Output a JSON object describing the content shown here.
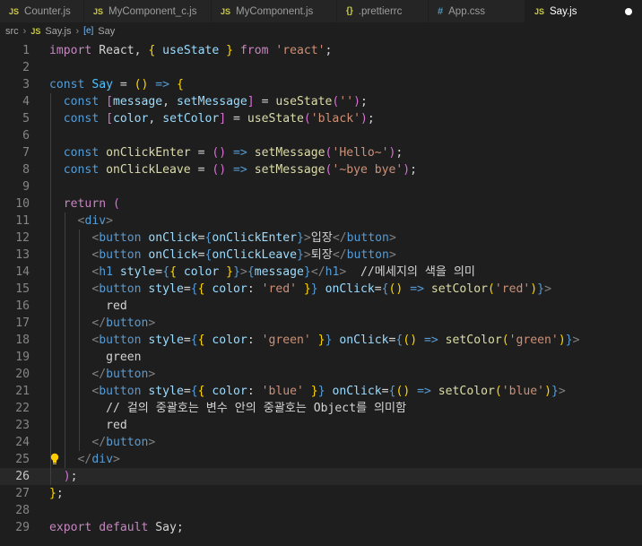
{
  "tabs": [
    {
      "icon": "JS",
      "label": "Counter.js",
      "active": false
    },
    {
      "icon": "JS",
      "label": "MyComponent_c.js",
      "active": false
    },
    {
      "icon": "JS",
      "label": "MyComponent.js",
      "active": false
    },
    {
      "icon": "{}",
      "label": ".prettierrc",
      "active": false
    },
    {
      "icon": "#",
      "label": "App.css",
      "active": false
    },
    {
      "icon": "JS",
      "label": "Say.js",
      "active": true,
      "dirty": true
    }
  ],
  "breadcrumb": {
    "folder": "src",
    "file_icon": "JS",
    "file": "Say.js",
    "symbol_icon": "[e]",
    "symbol": "Say"
  },
  "editor": {
    "current_line": 26,
    "lightbulb_line": 25,
    "lines": [
      {
        "n": 1,
        "tokens": [
          [
            "k",
            "import"
          ],
          [
            "p",
            " React, "
          ],
          [
            "b1",
            "{"
          ],
          [
            "p",
            " "
          ],
          [
            "v",
            "useState"
          ],
          [
            "p",
            " "
          ],
          [
            "b1",
            "}"
          ],
          [
            "p",
            " "
          ],
          [
            "k",
            "from"
          ],
          [
            "p",
            " "
          ],
          [
            "s",
            "'react'"
          ],
          [
            "p",
            ";"
          ]
        ]
      },
      {
        "n": 2,
        "tokens": []
      },
      {
        "n": 3,
        "tokens": [
          [
            "kb",
            "const"
          ],
          [
            "p",
            " "
          ],
          [
            "c",
            "Say"
          ],
          [
            "p",
            " = "
          ],
          [
            "b1",
            "()"
          ],
          [
            "p",
            " "
          ],
          [
            "kb",
            "=>"
          ],
          [
            "p",
            " "
          ],
          [
            "b1",
            "{"
          ]
        ]
      },
      {
        "n": 4,
        "tokens": [
          [
            "p",
            "  "
          ],
          [
            "kb",
            "const"
          ],
          [
            "p",
            " "
          ],
          [
            "b2",
            "["
          ],
          [
            "v",
            "message"
          ],
          [
            "p",
            ", "
          ],
          [
            "v",
            "setMessage"
          ],
          [
            "b2",
            "]"
          ],
          [
            "p",
            " = "
          ],
          [
            "f",
            "useState"
          ],
          [
            "b2",
            "("
          ],
          [
            "s",
            "''"
          ],
          [
            "b2",
            ")"
          ],
          [
            "p",
            ";"
          ]
        ]
      },
      {
        "n": 5,
        "tokens": [
          [
            "p",
            "  "
          ],
          [
            "kb",
            "const"
          ],
          [
            "p",
            " "
          ],
          [
            "b2",
            "["
          ],
          [
            "v",
            "color"
          ],
          [
            "p",
            ", "
          ],
          [
            "v",
            "setColor"
          ],
          [
            "b2",
            "]"
          ],
          [
            "p",
            " = "
          ],
          [
            "f",
            "useState"
          ],
          [
            "b2",
            "("
          ],
          [
            "s",
            "'black'"
          ],
          [
            "b2",
            ")"
          ],
          [
            "p",
            ";"
          ]
        ]
      },
      {
        "n": 6,
        "tokens": []
      },
      {
        "n": 7,
        "tokens": [
          [
            "p",
            "  "
          ],
          [
            "kb",
            "const"
          ],
          [
            "p",
            " "
          ],
          [
            "f",
            "onClickEnter"
          ],
          [
            "p",
            " = "
          ],
          [
            "b2",
            "()"
          ],
          [
            "p",
            " "
          ],
          [
            "kb",
            "=>"
          ],
          [
            "p",
            " "
          ],
          [
            "f",
            "setMessage"
          ],
          [
            "b2",
            "("
          ],
          [
            "s",
            "'Hello~'"
          ],
          [
            "b2",
            ")"
          ],
          [
            "p",
            ";"
          ]
        ]
      },
      {
        "n": 8,
        "tokens": [
          [
            "p",
            "  "
          ],
          [
            "kb",
            "const"
          ],
          [
            "p",
            " "
          ],
          [
            "f",
            "onClickLeave"
          ],
          [
            "p",
            " = "
          ],
          [
            "b2",
            "()"
          ],
          [
            "p",
            " "
          ],
          [
            "kb",
            "=>"
          ],
          [
            "p",
            " "
          ],
          [
            "f",
            "setMessage"
          ],
          [
            "b2",
            "("
          ],
          [
            "s",
            "'~bye bye'"
          ],
          [
            "b2",
            ")"
          ],
          [
            "p",
            ";"
          ]
        ]
      },
      {
        "n": 9,
        "tokens": []
      },
      {
        "n": 10,
        "tokens": [
          [
            "p",
            "  "
          ],
          [
            "k",
            "return"
          ],
          [
            "p",
            " "
          ],
          [
            "b2",
            "("
          ]
        ]
      },
      {
        "n": 11,
        "tokens": [
          [
            "p",
            "    "
          ],
          [
            "tg",
            "<"
          ],
          [
            "t",
            "div"
          ],
          [
            "tg",
            ">"
          ]
        ]
      },
      {
        "n": 12,
        "tokens": [
          [
            "p",
            "      "
          ],
          [
            "tg",
            "<"
          ],
          [
            "t",
            "button"
          ],
          [
            "p",
            " "
          ],
          [
            "v",
            "onClick"
          ],
          [
            "p",
            "="
          ],
          [
            "t",
            "{"
          ],
          [
            "v",
            "onClickEnter"
          ],
          [
            "t",
            "}"
          ],
          [
            "tg",
            ">"
          ],
          [
            "p",
            "입장"
          ],
          [
            "tg",
            "</"
          ],
          [
            "t",
            "button"
          ],
          [
            "tg",
            ">"
          ]
        ]
      },
      {
        "n": 13,
        "tokens": [
          [
            "p",
            "      "
          ],
          [
            "tg",
            "<"
          ],
          [
            "t",
            "button"
          ],
          [
            "p",
            " "
          ],
          [
            "v",
            "onClick"
          ],
          [
            "p",
            "="
          ],
          [
            "t",
            "{"
          ],
          [
            "v",
            "onClickLeave"
          ],
          [
            "t",
            "}"
          ],
          [
            "tg",
            ">"
          ],
          [
            "p",
            "퇴장"
          ],
          [
            "tg",
            "</"
          ],
          [
            "t",
            "button"
          ],
          [
            "tg",
            ">"
          ]
        ]
      },
      {
        "n": 14,
        "tokens": [
          [
            "p",
            "      "
          ],
          [
            "tg",
            "<"
          ],
          [
            "t",
            "h1"
          ],
          [
            "p",
            " "
          ],
          [
            "v",
            "style"
          ],
          [
            "p",
            "="
          ],
          [
            "t",
            "{"
          ],
          [
            "b1",
            "{"
          ],
          [
            "p",
            " "
          ],
          [
            "v",
            "color"
          ],
          [
            "p",
            " "
          ],
          [
            "b1",
            "}"
          ],
          [
            "t",
            "}"
          ],
          [
            "tg",
            ">"
          ],
          [
            "t",
            "{"
          ],
          [
            "v",
            "message"
          ],
          [
            "t",
            "}"
          ],
          [
            "tg",
            "</"
          ],
          [
            "t",
            "h1"
          ],
          [
            "tg",
            ">"
          ],
          [
            "p",
            "  //메세지의 색을 의미"
          ]
        ]
      },
      {
        "n": 15,
        "tokens": [
          [
            "p",
            "      "
          ],
          [
            "tg",
            "<"
          ],
          [
            "t",
            "button"
          ],
          [
            "p",
            " "
          ],
          [
            "v",
            "style"
          ],
          [
            "p",
            "="
          ],
          [
            "t",
            "{"
          ],
          [
            "b1",
            "{"
          ],
          [
            "p",
            " "
          ],
          [
            "v",
            "color"
          ],
          [
            "p",
            ": "
          ],
          [
            "s",
            "'red'"
          ],
          [
            "p",
            " "
          ],
          [
            "b1",
            "}"
          ],
          [
            "t",
            "}"
          ],
          [
            "p",
            " "
          ],
          [
            "v",
            "onClick"
          ],
          [
            "p",
            "="
          ],
          [
            "t",
            "{"
          ],
          [
            "b1",
            "()"
          ],
          [
            "p",
            " "
          ],
          [
            "kb",
            "=>"
          ],
          [
            "p",
            " "
          ],
          [
            "f",
            "setColor"
          ],
          [
            "b1",
            "("
          ],
          [
            "s",
            "'red'"
          ],
          [
            "b1",
            ")"
          ],
          [
            "t",
            "}"
          ],
          [
            "tg",
            ">"
          ]
        ]
      },
      {
        "n": 16,
        "tokens": [
          [
            "p",
            "        red"
          ]
        ]
      },
      {
        "n": 17,
        "tokens": [
          [
            "p",
            "      "
          ],
          [
            "tg",
            "</"
          ],
          [
            "t",
            "button"
          ],
          [
            "tg",
            ">"
          ]
        ]
      },
      {
        "n": 18,
        "tokens": [
          [
            "p",
            "      "
          ],
          [
            "tg",
            "<"
          ],
          [
            "t",
            "button"
          ],
          [
            "p",
            " "
          ],
          [
            "v",
            "style"
          ],
          [
            "p",
            "="
          ],
          [
            "t",
            "{"
          ],
          [
            "b1",
            "{"
          ],
          [
            "p",
            " "
          ],
          [
            "v",
            "color"
          ],
          [
            "p",
            ": "
          ],
          [
            "s",
            "'green'"
          ],
          [
            "p",
            " "
          ],
          [
            "b1",
            "}"
          ],
          [
            "t",
            "}"
          ],
          [
            "p",
            " "
          ],
          [
            "v",
            "onClick"
          ],
          [
            "p",
            "="
          ],
          [
            "t",
            "{"
          ],
          [
            "b1",
            "()"
          ],
          [
            "p",
            " "
          ],
          [
            "kb",
            "=>"
          ],
          [
            "p",
            " "
          ],
          [
            "f",
            "setColor"
          ],
          [
            "b1",
            "("
          ],
          [
            "s",
            "'green'"
          ],
          [
            "b1",
            ")"
          ],
          [
            "t",
            "}"
          ],
          [
            "tg",
            ">"
          ]
        ]
      },
      {
        "n": 19,
        "tokens": [
          [
            "p",
            "        green"
          ]
        ]
      },
      {
        "n": 20,
        "tokens": [
          [
            "p",
            "      "
          ],
          [
            "tg",
            "</"
          ],
          [
            "t",
            "button"
          ],
          [
            "tg",
            ">"
          ]
        ]
      },
      {
        "n": 21,
        "tokens": [
          [
            "p",
            "      "
          ],
          [
            "tg",
            "<"
          ],
          [
            "t",
            "button"
          ],
          [
            "p",
            " "
          ],
          [
            "v",
            "style"
          ],
          [
            "p",
            "="
          ],
          [
            "t",
            "{"
          ],
          [
            "b1",
            "{"
          ],
          [
            "p",
            " "
          ],
          [
            "v",
            "color"
          ],
          [
            "p",
            ": "
          ],
          [
            "s",
            "'blue'"
          ],
          [
            "p",
            " "
          ],
          [
            "b1",
            "}"
          ],
          [
            "t",
            "}"
          ],
          [
            "p",
            " "
          ],
          [
            "v",
            "onClick"
          ],
          [
            "p",
            "="
          ],
          [
            "t",
            "{"
          ],
          [
            "b1",
            "()"
          ],
          [
            "p",
            " "
          ],
          [
            "kb",
            "=>"
          ],
          [
            "p",
            " "
          ],
          [
            "f",
            "setColor"
          ],
          [
            "b1",
            "("
          ],
          [
            "s",
            "'blue'"
          ],
          [
            "b1",
            ")"
          ],
          [
            "t",
            "}"
          ],
          [
            "tg",
            ">"
          ]
        ]
      },
      {
        "n": 22,
        "tokens": [
          [
            "p",
            "        // 겉의 중괄호는 변수 안의 중괄호는 Object를 의미함"
          ]
        ]
      },
      {
        "n": 23,
        "tokens": [
          [
            "p",
            "        red"
          ]
        ]
      },
      {
        "n": 24,
        "tokens": [
          [
            "p",
            "      "
          ],
          [
            "tg",
            "</"
          ],
          [
            "t",
            "button"
          ],
          [
            "tg",
            ">"
          ]
        ]
      },
      {
        "n": 25,
        "tokens": [
          [
            "p",
            "    "
          ],
          [
            "tg",
            "</"
          ],
          [
            "t",
            "div"
          ],
          [
            "tg",
            ">"
          ]
        ]
      },
      {
        "n": 26,
        "tokens": [
          [
            "p",
            "  "
          ],
          [
            "b2",
            ")"
          ],
          [
            "p",
            ";"
          ]
        ]
      },
      {
        "n": 27,
        "tokens": [
          [
            "b1",
            "}"
          ],
          [
            "p",
            ";"
          ]
        ]
      },
      {
        "n": 28,
        "tokens": []
      },
      {
        "n": 29,
        "tokens": [
          [
            "k",
            "export"
          ],
          [
            "p",
            " "
          ],
          [
            "k",
            "default"
          ],
          [
            "p",
            " Say;"
          ]
        ]
      }
    ]
  }
}
